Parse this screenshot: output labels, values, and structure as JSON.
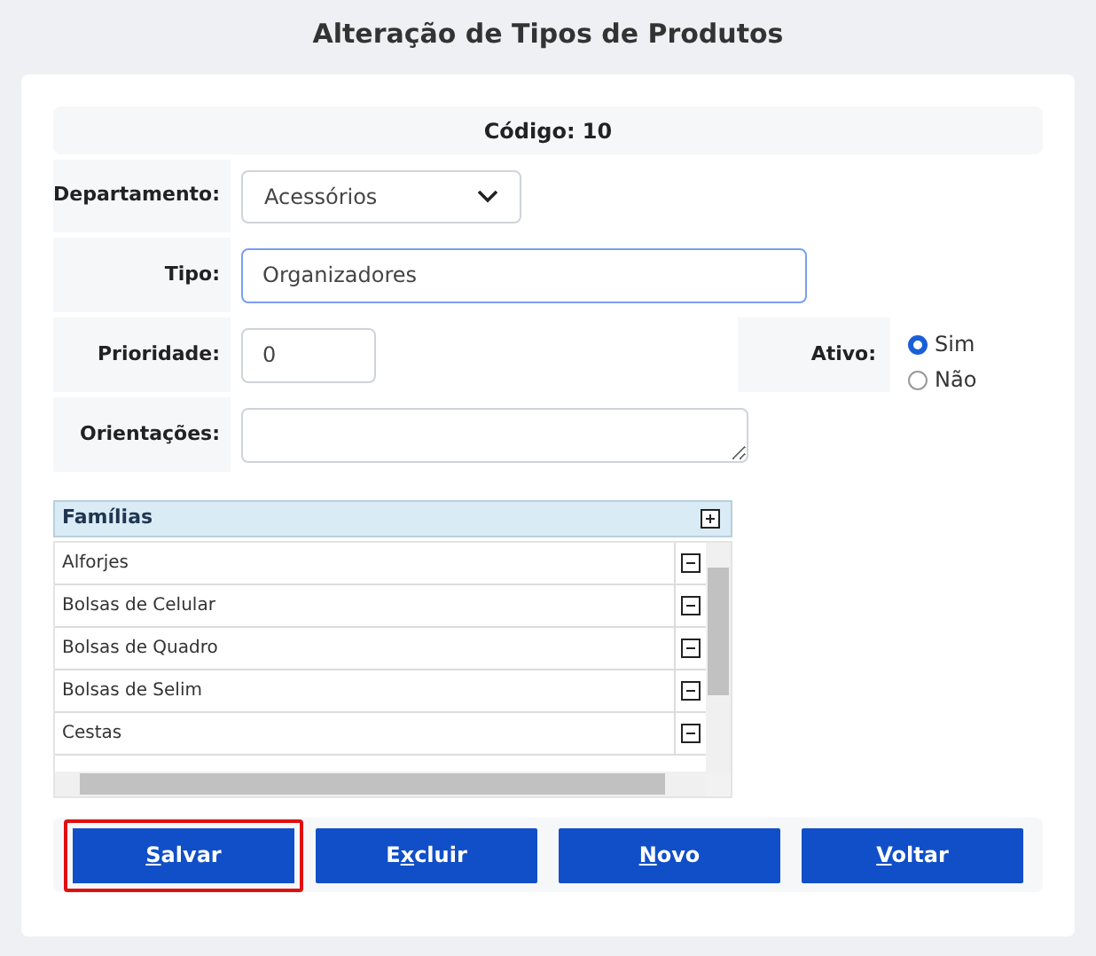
{
  "title": "Alteração de Tipos de Produtos",
  "code": "Código: 10",
  "fields": [
    {
      "kind": "select",
      "label": "Departamento:",
      "value": "Acessórios"
    },
    {
      "kind": "text",
      "label": "Tipo:",
      "value": "Organizadores",
      "focused": true
    },
    {
      "kind": "number",
      "label": "Prioridade:",
      "value": "0",
      "focused": false
    },
    {
      "kind": "textarea",
      "label": "Orientações:"
    }
  ],
  "ativo": {
    "label": "Ativo:",
    "options": [
      {
        "label": "Sim",
        "selected": true
      },
      {
        "label": "Não",
        "selected": false
      }
    ]
  },
  "familias": {
    "header": "Famílias",
    "items": [
      "Alforjes",
      "Bolsas de Celular",
      "Bolsas de Quadro",
      "Bolsas de Selim",
      "Cestas"
    ]
  },
  "buttons": [
    {
      "key": "S",
      "after": "alvar",
      "highlighted": true
    },
    {
      "before": "E",
      "key": "x",
      "after": "cluir",
      "highlighted": false
    },
    {
      "key": "N",
      "after": "ovo",
      "highlighted": false
    },
    {
      "key": "V",
      "after": "oltar",
      "highlighted": false
    }
  ]
}
